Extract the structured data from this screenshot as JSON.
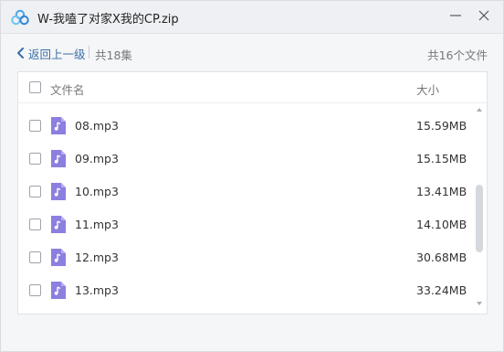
{
  "window": {
    "title": "W-我嗑了对家X我的CP.zip"
  },
  "toolbar": {
    "back_label": "返回上一级",
    "episode_count": "共18集",
    "total_files": "共16个文件"
  },
  "table": {
    "columns": {
      "name": "文件名",
      "size": "大小"
    },
    "rows": [
      {
        "name": "08.mp3",
        "size": "15.59MB"
      },
      {
        "name": "09.mp3",
        "size": "15.15MB"
      },
      {
        "name": "10.mp3",
        "size": "13.41MB"
      },
      {
        "name": "11.mp3",
        "size": "14.10MB"
      },
      {
        "name": "12.mp3",
        "size": "30.68MB"
      },
      {
        "name": "13.mp3",
        "size": "33.24MB"
      }
    ]
  },
  "colors": {
    "accent": "#3a6ea5",
    "audio_icon": "#8b7fe0"
  },
  "icons": {
    "app": "cloud-logo-icon",
    "file": "audio-file-icon",
    "back": "chevron-left-icon"
  }
}
